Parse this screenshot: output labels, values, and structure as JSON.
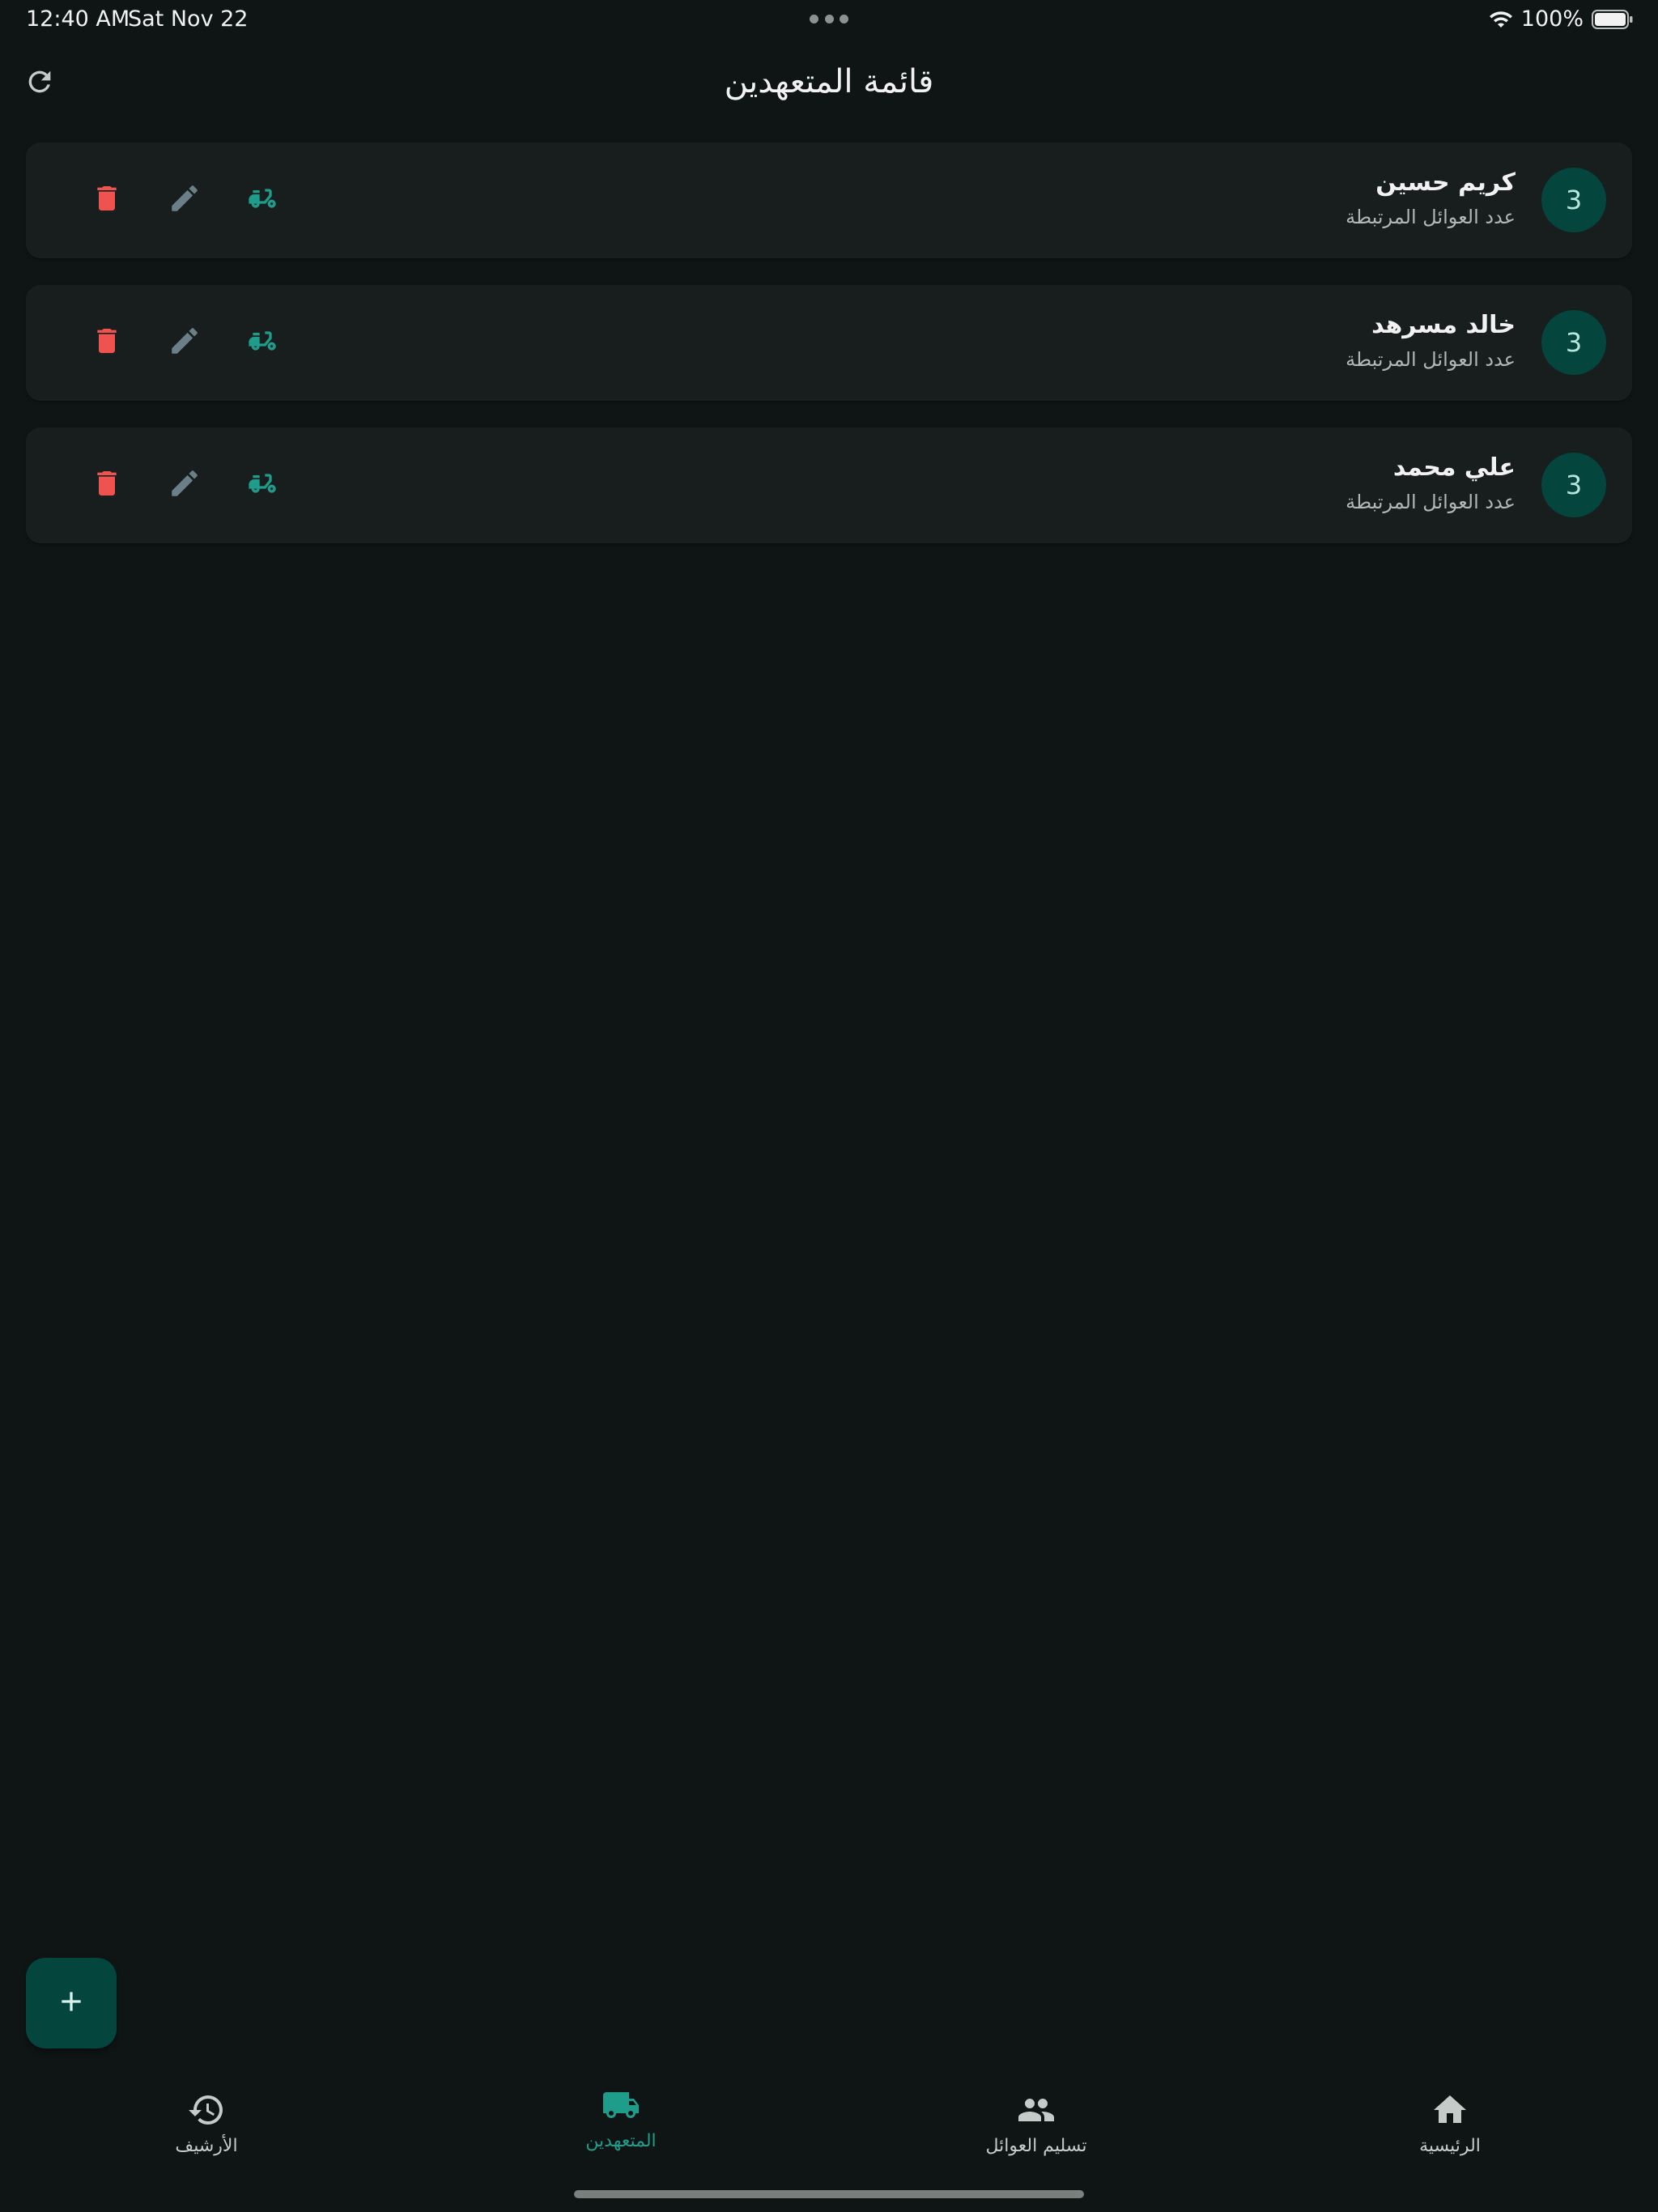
{
  "status_bar": {
    "time": "12:40 AM",
    "date": "Sat Nov 22",
    "battery": "100%"
  },
  "header": {
    "title": "قائمة المتعهدين"
  },
  "volunteers": [
    {
      "name": "كريم حسين",
      "subtitle": "عدد العوائل المرتبطة",
      "count": "3"
    },
    {
      "name": "خالد مسرهد",
      "subtitle": "عدد العوائل المرتبطة",
      "count": "3"
    },
    {
      "name": "علي محمد",
      "subtitle": "عدد العوائل المرتبطة",
      "count": "3"
    }
  ],
  "bottom_nav": {
    "archive": "الأرشيف",
    "volunteers": "المتعهدين",
    "delivery": "تسليم العوائل",
    "home": "الرئيسية"
  },
  "colors": {
    "background": "#0f1515",
    "card": "#181e1e",
    "accent": "#1f9d8b",
    "avatar": "#04453e",
    "delete": "#ef5350",
    "edit": "#6b7f88"
  },
  "icons": {
    "refresh": "refresh-icon",
    "delete": "trash-icon",
    "edit": "pencil-icon",
    "assign": "scooter-icon",
    "add": "plus-icon"
  }
}
